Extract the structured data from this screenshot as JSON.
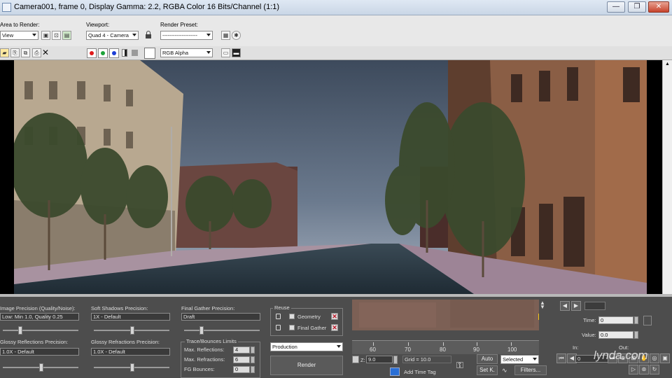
{
  "window": {
    "title": "Camera001, frame 0, Display Gamma: 2.2, RGBA Color 16 Bits/Channel (1:1)",
    "minimize_label": "—",
    "restore_label": "❐",
    "close_label": "✕"
  },
  "toolbar": {
    "area_label": "Area to Render:",
    "area_value": "View",
    "viewport_label": "Viewport:",
    "viewport_value": "Quad 4 - Camera",
    "preset_label": "Render Preset:",
    "preset_value": "--------------------",
    "channel_value": "RGB Alpha"
  },
  "colors": {
    "red_channel": "#e01b1b",
    "green_channel": "#1da33a",
    "blue_channel": "#1d3fd6",
    "accent_blue": "#2a6fd6",
    "key_frame_marker": "#f5c518"
  },
  "settings": {
    "image_precision_label": "Image Precision (Quality/Noise):",
    "image_precision_value": "Low: Min 1.0, Quality 0.25",
    "soft_shadows_label": "Soft Shadows Precision:",
    "soft_shadows_value": "1X - Default",
    "final_gather_label": "Final Gather Precision:",
    "final_gather_value": "Draft",
    "glossy_reflections_label": "Glossy Reflections Precision:",
    "glossy_reflections_value": "1.0X - Default",
    "glossy_refractions_label": "Glossy Refractions Precision:",
    "glossy_refractions_value": "1.0X - Default",
    "trace_group_label": "Trace/Bounces Limits",
    "max_reflections_label": "Max. Reflections:",
    "max_reflections_value": "4",
    "max_refractions_label": "Max. Refractions:",
    "max_refractions_value": "6",
    "fg_bounces_label": "FG Bounces:",
    "fg_bounces_value": "0",
    "reuse_label": "Reuse",
    "geometry_label": "Geometry",
    "final_gather_reuse_label": "Final Gather",
    "mode_value": "Production",
    "render_button": "Render"
  },
  "timeline": {
    "ticks": [
      "60",
      "70",
      "80",
      "90",
      "100"
    ],
    "z_label": "Z:",
    "z_value": "9.0",
    "grid_label": "Grid = 10.0",
    "add_time_tag": "Add Time Tag",
    "auto_button": "Auto",
    "set_key_button": "Set K.",
    "key_filter_value": "Selected",
    "filters_button": "Filters..."
  },
  "right_panel": {
    "time_label": "Time:",
    "time_value": "0",
    "value_label": "Value:",
    "value_value": "0.0",
    "in_label": "In:",
    "out_label": "Out:",
    "frame_value": "0"
  },
  "watermark": "lynda.com"
}
